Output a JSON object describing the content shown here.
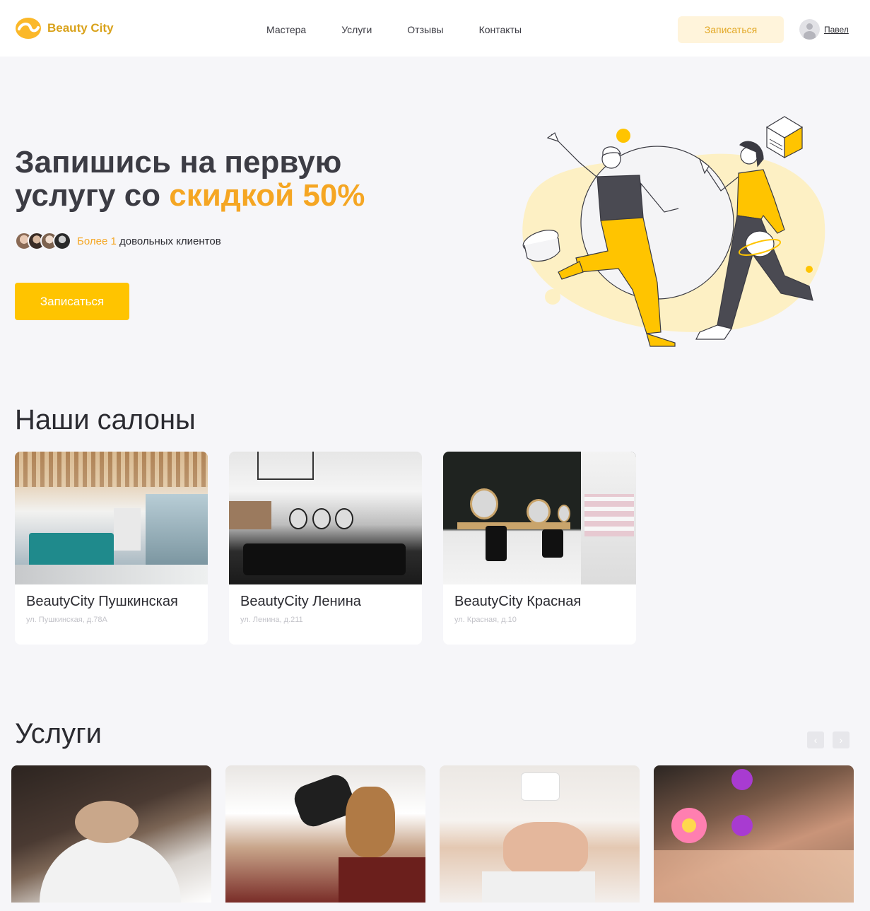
{
  "header": {
    "brand": "Beauty City",
    "nav": [
      "Мастера",
      "Услуги",
      "Отзывы",
      "Контакты"
    ],
    "book_label": "Записаться",
    "user_name": "Павел"
  },
  "hero": {
    "title_line1": "Запишись на первую",
    "title_line2_plain": "услугу со ",
    "title_line2_accent": "скидкой 50%",
    "clients_prefix": "Более 1",
    "clients_suffix": " довольных клиентов",
    "cta_label": "Записаться"
  },
  "salons": {
    "title": "Наши салоны",
    "items": [
      {
        "name": "BeautyCity Пушкинская",
        "address": "ул. Пушкинская, д.78А"
      },
      {
        "name": "BeautyCity Ленина",
        "address": "ул. Ленина, д.211"
      },
      {
        "name": "BeautyCity Красная",
        "address": "ул. Красная, д.10"
      }
    ]
  },
  "services": {
    "title": "Услуги",
    "prev_icon": "‹",
    "next_icon": "›"
  },
  "colors": {
    "accent": "#f5a623",
    "button": "#ffc400",
    "soft_button": "#fff4db",
    "background": "#f6f6f9"
  }
}
